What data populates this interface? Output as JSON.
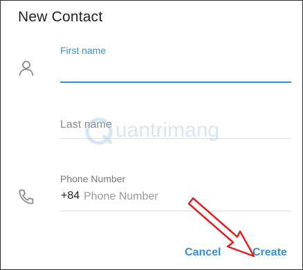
{
  "dialog": {
    "title": "New Contact",
    "first_name": {
      "label": "First name",
      "value": ""
    },
    "last_name": {
      "placeholder": "Last name"
    },
    "phone": {
      "label": "Phone Number",
      "country_code": "+84",
      "placeholder": "Phone Number"
    },
    "buttons": {
      "cancel": "Cancel",
      "create": "Create"
    }
  },
  "overlays": {
    "watermark_text": "uantrimang",
    "annotation_arrow_color": "#e02020"
  },
  "colors": {
    "accent": "#3390d8",
    "text": "#222222",
    "muted": "#8a8a8a",
    "divider": "#dedede",
    "border": "#2b2b2b"
  },
  "icons": {
    "contact": "person-icon",
    "phone": "phone-icon"
  }
}
